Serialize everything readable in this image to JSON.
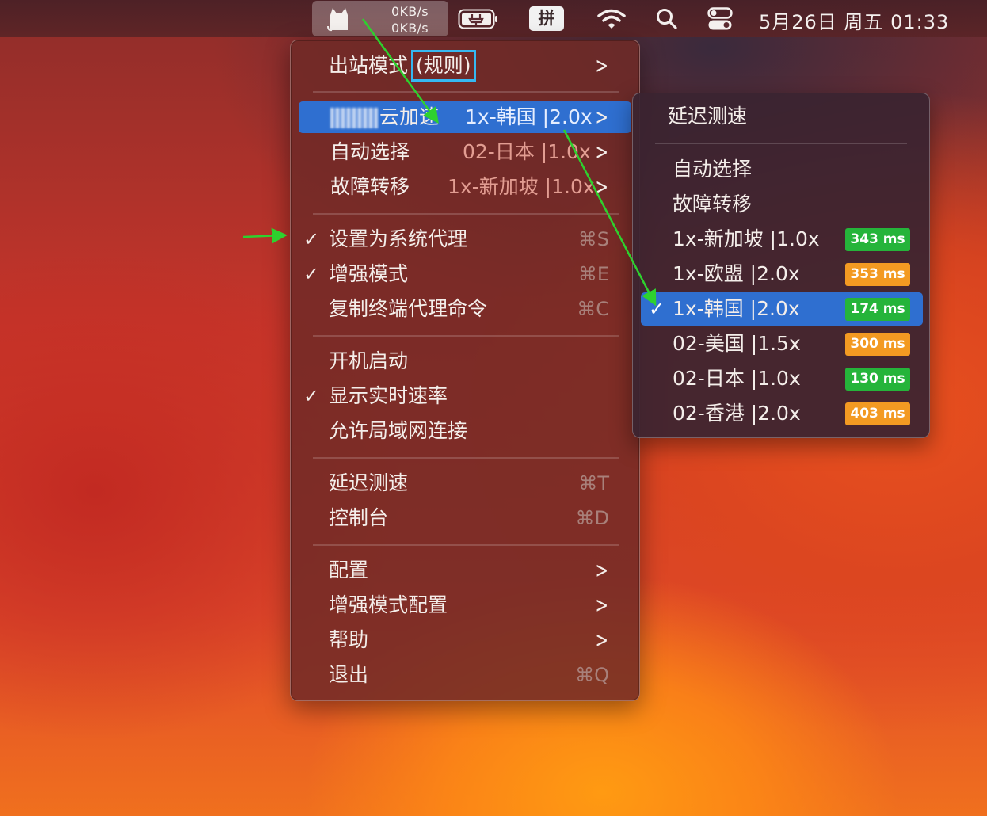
{
  "menubar": {
    "upload_speed": "0KB/s",
    "download_speed": "0KB/s",
    "input_method": "拼",
    "clock": "5月26日 周五 01:33",
    "icons": [
      "clash-cat-icon",
      "battery-charging-icon",
      "input-method-icon",
      "wifi-icon",
      "search-icon",
      "control-center-icon"
    ]
  },
  "menu": {
    "outbound_mode": {
      "label": "出站模式",
      "value": "(规则)"
    },
    "proxy_groups": [
      {
        "label": "云加速",
        "value": "1x-韩国 |2.0x"
      },
      {
        "label": "自动选择",
        "value": "02-日本 |1.0x"
      },
      {
        "label": "故障转移",
        "value": "1x-新加坡 |1.0x"
      }
    ],
    "settings": [
      {
        "label": "设置为系统代理",
        "checked": "✓",
        "shortcut": "⌘S"
      },
      {
        "label": "增强模式",
        "checked": "✓",
        "shortcut": "⌘E"
      },
      {
        "label": "复制终端代理命令",
        "checked": "",
        "shortcut": "⌘C"
      }
    ],
    "options": [
      {
        "label": "开机启动",
        "checked": ""
      },
      {
        "label": "显示实时速率",
        "checked": "✓"
      },
      {
        "label": "允许局域网连接",
        "checked": ""
      }
    ],
    "tools": [
      {
        "label": "延迟测速",
        "shortcut": "⌘T"
      },
      {
        "label": "控制台",
        "shortcut": "⌘D"
      }
    ],
    "more": [
      {
        "label": "配置"
      },
      {
        "label": "增强模式配置"
      },
      {
        "label": "帮助"
      },
      {
        "label": "退出",
        "shortcut": "⌘Q"
      }
    ]
  },
  "submenu": {
    "latency_test": "延迟测速",
    "groups": [
      "自动选择",
      "故障转移"
    ],
    "nodes": [
      {
        "label": "1x-新加坡 |1.0x",
        "latency": "343 ms",
        "color": "#25b43a",
        "selected": ""
      },
      {
        "label": "1x-欧盟 |2.0x",
        "latency": "353 ms",
        "color": "#f39a22",
        "selected": ""
      },
      {
        "label": "1x-韩国 |2.0x",
        "latency": "174 ms",
        "color": "#25b43a",
        "selected": "✓"
      },
      {
        "label": "02-美国 |1.5x",
        "latency": "300 ms",
        "color": "#f39a22",
        "selected": ""
      },
      {
        "label": "02-日本 |1.0x",
        "latency": "130 ms",
        "color": "#25b43a",
        "selected": ""
      },
      {
        "label": "02-香港 |2.0x",
        "latency": "403 ms",
        "color": "#f39a22",
        "selected": ""
      }
    ]
  }
}
